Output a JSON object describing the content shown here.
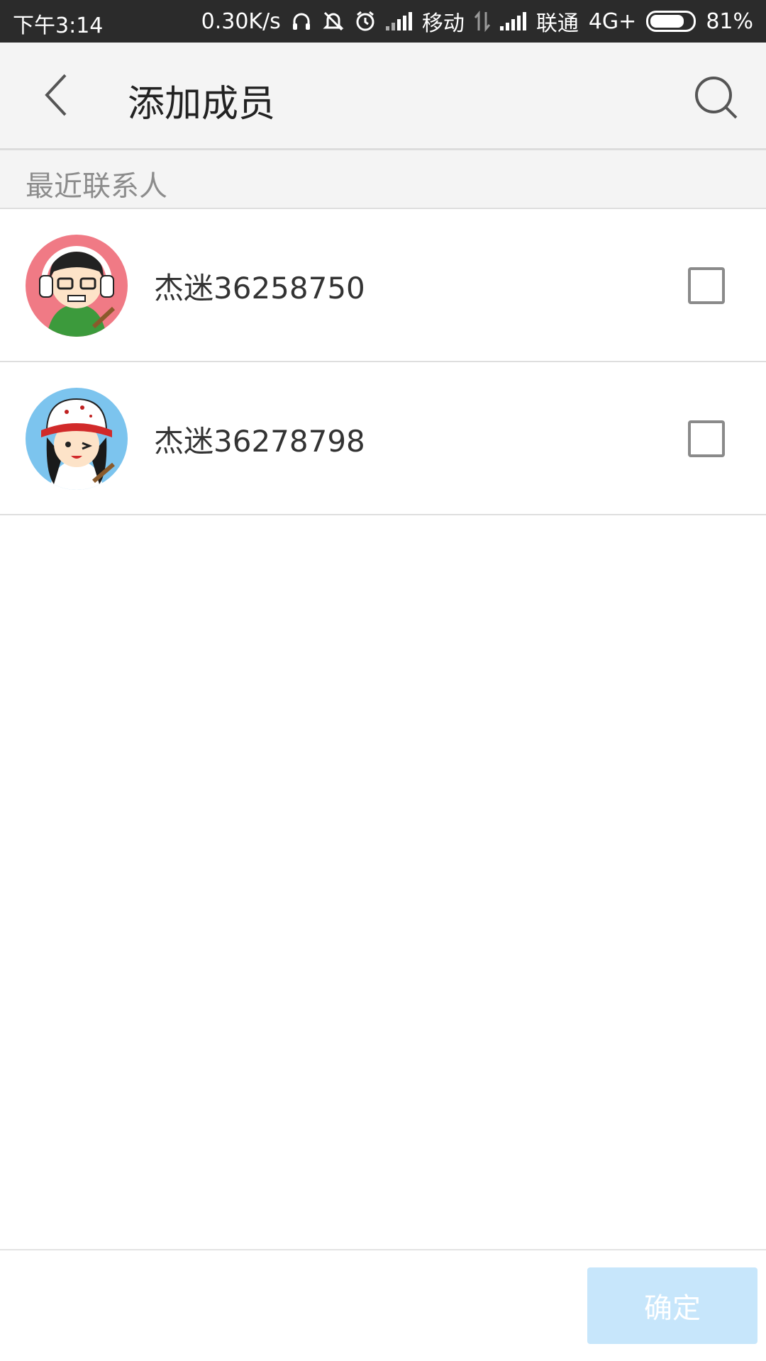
{
  "status_bar": {
    "time": "下午3:14",
    "network_speed": "0.30K/s",
    "carrier1": "移动",
    "carrier2": "联通",
    "network_type": "4G+",
    "battery_percent": "81%",
    "battery_level": 0.81,
    "icons": [
      "headphones-icon",
      "mute-icon",
      "alarm-icon",
      "signal-icon",
      "data-arrows-icon",
      "signal-icon",
      "battery-icon"
    ]
  },
  "header": {
    "title": "添加成员",
    "back_icon": "chevron-left-icon",
    "search_icon": "search-icon"
  },
  "section": {
    "label": "最近联系人"
  },
  "contacts": [
    {
      "name": "杰迷36258750",
      "checked": false,
      "avatar": "cartoon-avatar-headphones",
      "avatar_bg": "#f07a85"
    },
    {
      "name": "杰迷36278798",
      "checked": false,
      "avatar": "cartoon-avatar-cap",
      "avatar_bg": "#7cc4ee"
    }
  ],
  "footer": {
    "confirm_label": "确定"
  },
  "colors": {
    "header_bg": "#f4f4f4",
    "confirm_disabled_bg": "#c7e6fb",
    "status_bar_bg": "#2b2b2b"
  }
}
